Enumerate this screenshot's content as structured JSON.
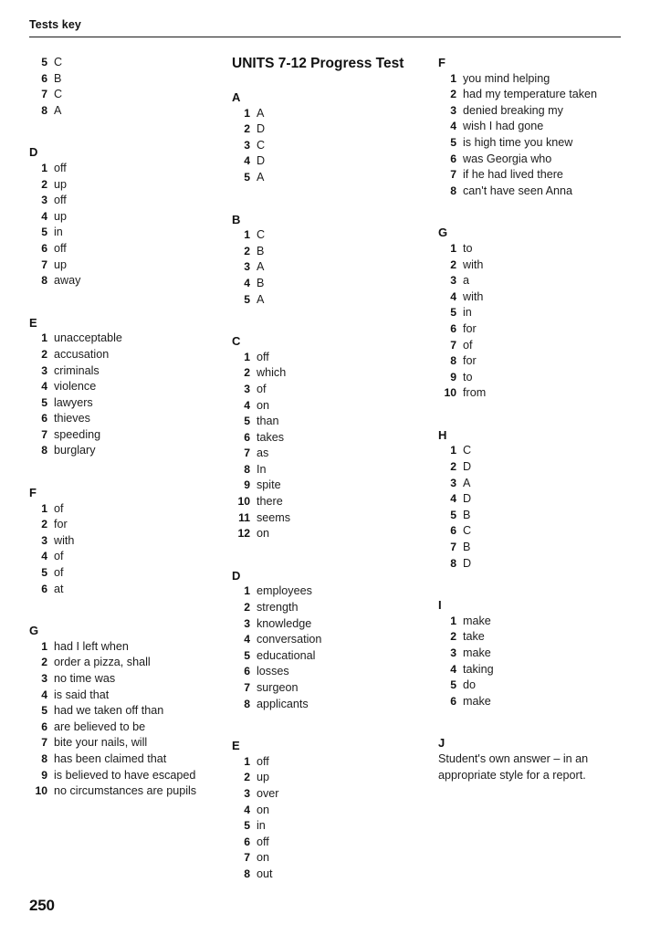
{
  "header": {
    "title": "Tests key"
  },
  "folio": "250",
  "columns": [
    {
      "name": "column-left",
      "sections": [
        {
          "letter": "",
          "items": [
            {
              "num": "5",
              "text": "C"
            },
            {
              "num": "6",
              "text": "B"
            },
            {
              "num": "7",
              "text": "C"
            },
            {
              "num": "8",
              "text": "A"
            }
          ]
        },
        {
          "letter": "D",
          "items": [
            {
              "num": "1",
              "text": "off"
            },
            {
              "num": "2",
              "text": "up"
            },
            {
              "num": "3",
              "text": "off"
            },
            {
              "num": "4",
              "text": "up"
            },
            {
              "num": "5",
              "text": "in"
            },
            {
              "num": "6",
              "text": "off"
            },
            {
              "num": "7",
              "text": "up"
            },
            {
              "num": "8",
              "text": "away"
            }
          ]
        },
        {
          "letter": "E",
          "items": [
            {
              "num": "1",
              "text": "unacceptable"
            },
            {
              "num": "2",
              "text": "accusation"
            },
            {
              "num": "3",
              "text": "criminals"
            },
            {
              "num": "4",
              "text": "violence"
            },
            {
              "num": "5",
              "text": "lawyers"
            },
            {
              "num": "6",
              "text": "thieves"
            },
            {
              "num": "7",
              "text": "speeding"
            },
            {
              "num": "8",
              "text": "burglary"
            }
          ]
        },
        {
          "letter": "F",
          "items": [
            {
              "num": "1",
              "text": "of"
            },
            {
              "num": "2",
              "text": "for"
            },
            {
              "num": "3",
              "text": "with"
            },
            {
              "num": "4",
              "text": "of"
            },
            {
              "num": "5",
              "text": "of"
            },
            {
              "num": "6",
              "text": "at"
            }
          ]
        },
        {
          "letter": "G",
          "items": [
            {
              "num": "1",
              "text": "had I left when"
            },
            {
              "num": "2",
              "text": "order a pizza, shall"
            },
            {
              "num": "3",
              "text": "no time was"
            },
            {
              "num": "4",
              "text": "is said that"
            },
            {
              "num": "5",
              "text": "had we taken off than"
            },
            {
              "num": "6",
              "text": "are believed to be"
            },
            {
              "num": "7",
              "text": "bite your nails, will"
            },
            {
              "num": "8",
              "text": "has been claimed that"
            },
            {
              "num": "9",
              "text": "is believed to have escaped"
            },
            {
              "num": "10",
              "text": "no circumstances are pupils"
            }
          ]
        }
      ]
    },
    {
      "name": "column-middle",
      "title": "UNITS 7-12 Progress Test",
      "sections": [
        {
          "letter": "A",
          "items": [
            {
              "num": "1",
              "text": "A"
            },
            {
              "num": "2",
              "text": "D"
            },
            {
              "num": "3",
              "text": "C"
            },
            {
              "num": "4",
              "text": "D"
            },
            {
              "num": "5",
              "text": "A"
            }
          ]
        },
        {
          "letter": "B",
          "items": [
            {
              "num": "1",
              "text": "C"
            },
            {
              "num": "2",
              "text": "B"
            },
            {
              "num": "3",
              "text": "A"
            },
            {
              "num": "4",
              "text": "B"
            },
            {
              "num": "5",
              "text": "A"
            }
          ]
        },
        {
          "letter": "C",
          "items": [
            {
              "num": "1",
              "text": "off"
            },
            {
              "num": "2",
              "text": "which"
            },
            {
              "num": "3",
              "text": "of"
            },
            {
              "num": "4",
              "text": "on"
            },
            {
              "num": "5",
              "text": "than"
            },
            {
              "num": "6",
              "text": "takes"
            },
            {
              "num": "7",
              "text": "as"
            },
            {
              "num": "8",
              "text": "In"
            },
            {
              "num": "9",
              "text": "spite"
            },
            {
              "num": "10",
              "text": "there"
            },
            {
              "num": "11",
              "text": "seems"
            },
            {
              "num": "12",
              "text": "on"
            }
          ]
        },
        {
          "letter": "D",
          "items": [
            {
              "num": "1",
              "text": "employees"
            },
            {
              "num": "2",
              "text": "strength"
            },
            {
              "num": "3",
              "text": "knowledge"
            },
            {
              "num": "4",
              "text": "conversation"
            },
            {
              "num": "5",
              "text": "educational"
            },
            {
              "num": "6",
              "text": "losses"
            },
            {
              "num": "7",
              "text": "surgeon"
            },
            {
              "num": "8",
              "text": "applicants"
            }
          ]
        },
        {
          "letter": "E",
          "items": [
            {
              "num": "1",
              "text": "off"
            },
            {
              "num": "2",
              "text": "up"
            },
            {
              "num": "3",
              "text": "over"
            },
            {
              "num": "4",
              "text": "on"
            },
            {
              "num": "5",
              "text": "in"
            },
            {
              "num": "6",
              "text": "off"
            },
            {
              "num": "7",
              "text": "on"
            },
            {
              "num": "8",
              "text": "out"
            }
          ]
        }
      ]
    },
    {
      "name": "column-right",
      "sections": [
        {
          "letter": "F",
          "items": [
            {
              "num": "1",
              "text": "you mind helping"
            },
            {
              "num": "2",
              "text": "had my temperature taken"
            },
            {
              "num": "3",
              "text": "denied breaking my"
            },
            {
              "num": "4",
              "text": "wish I had gone"
            },
            {
              "num": "5",
              "text": "is high time you knew"
            },
            {
              "num": "6",
              "text": "was Georgia who"
            },
            {
              "num": "7",
              "text": "if he had lived there"
            },
            {
              "num": "8",
              "text": "can't have seen Anna"
            }
          ]
        },
        {
          "letter": "G",
          "items": [
            {
              "num": "1",
              "text": "to"
            },
            {
              "num": "2",
              "text": "with"
            },
            {
              "num": "3",
              "text": "a"
            },
            {
              "num": "4",
              "text": "with"
            },
            {
              "num": "5",
              "text": "in"
            },
            {
              "num": "6",
              "text": "for"
            },
            {
              "num": "7",
              "text": "of"
            },
            {
              "num": "8",
              "text": "for"
            },
            {
              "num": "9",
              "text": "to"
            },
            {
              "num": "10",
              "text": "from"
            }
          ]
        },
        {
          "letter": "H",
          "items": [
            {
              "num": "1",
              "text": "C"
            },
            {
              "num": "2",
              "text": "D"
            },
            {
              "num": "3",
              "text": "A"
            },
            {
              "num": "4",
              "text": "D"
            },
            {
              "num": "5",
              "text": "B"
            },
            {
              "num": "6",
              "text": "C"
            },
            {
              "num": "7",
              "text": "B"
            },
            {
              "num": "8",
              "text": "D"
            }
          ]
        },
        {
          "letter": "I",
          "items": [
            {
              "num": "1",
              "text": "make"
            },
            {
              "num": "2",
              "text": "take"
            },
            {
              "num": "3",
              "text": "make"
            },
            {
              "num": "4",
              "text": "taking"
            },
            {
              "num": "5",
              "text": "do"
            },
            {
              "num": "6",
              "text": "make"
            }
          ]
        },
        {
          "letter": "J",
          "paragraph": "Student's own answer – in an appropriate style for a report."
        }
      ]
    }
  ]
}
